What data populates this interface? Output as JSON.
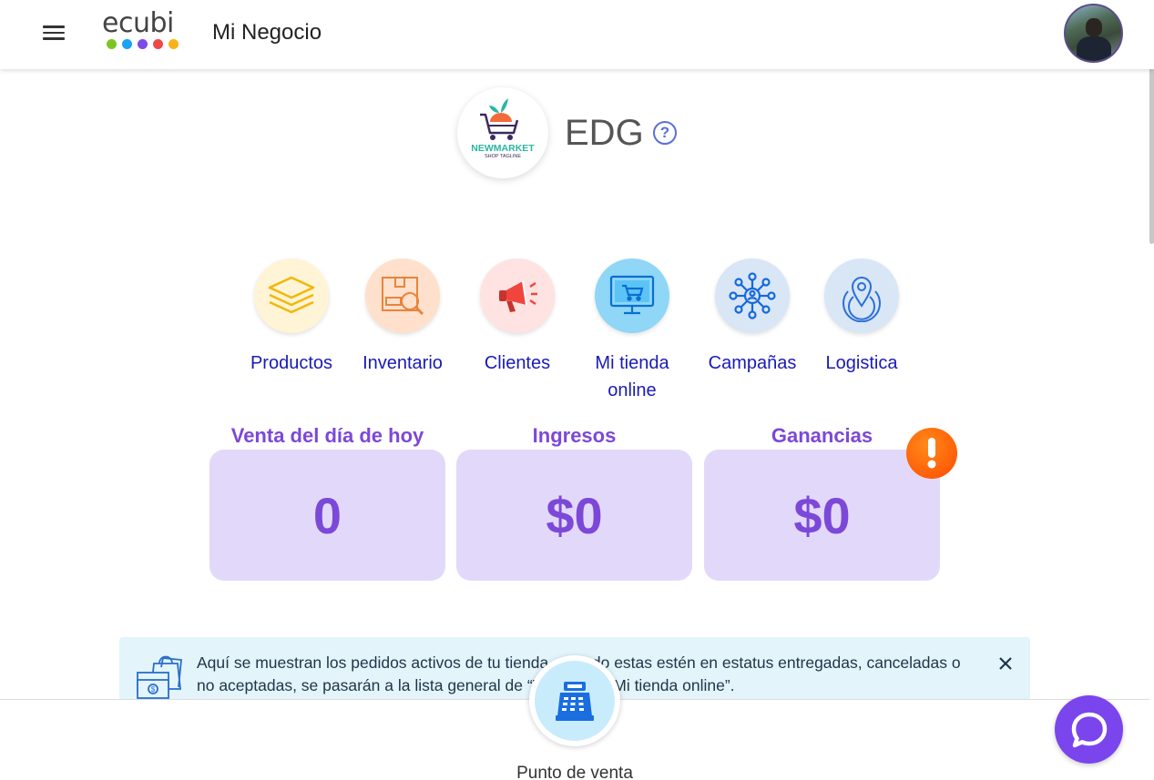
{
  "header": {
    "menu_icon": "hamburger-menu-icon",
    "logo_text": "ecubi",
    "logo_dot_colors": [
      "#7cc623",
      "#1aa3f0",
      "#7d4ce6",
      "#f04848",
      "#f7b319"
    ],
    "title": "Mi Negocio",
    "avatar": "user-avatar"
  },
  "store": {
    "logo_name": "NEWMARKET",
    "logo_tagline": "SHOP TAGLINE",
    "name": "EDG",
    "help_glyph": "?"
  },
  "modules": [
    {
      "label": "Productos",
      "icon": "layers-icon",
      "bg": "#fff4d6"
    },
    {
      "label": "Inventario",
      "icon": "box-search-icon",
      "bg": "#ffe0cc"
    },
    {
      "label": "Clientes",
      "icon": "megaphone-icon",
      "bg": "#ffe2e2"
    },
    {
      "label": "Mi tienda online",
      "icon": "online-store-icon",
      "bg": "#8fd6f7"
    },
    {
      "label": "Campañas",
      "icon": "network-icon",
      "bg": "#d8e6f6"
    },
    {
      "label": "Logistica",
      "icon": "location-pin-icon",
      "bg": "#d8e6f6"
    }
  ],
  "stats": [
    {
      "title": "Venta del día de hoy",
      "value": "0"
    },
    {
      "title": "Ingresos",
      "value": "$0"
    },
    {
      "title": "Ganancias",
      "value": "$0"
    }
  ],
  "alert_glyph": "!",
  "info": {
    "line1": "Aquí se muestran los pedidos activos de tu tienda, cuando estas estén en estatus entregadas, canceladas o",
    "line2": "no aceptadas, se pasarán a la lista general de “Ventas” en Mi tienda online”."
  },
  "bottom": {
    "pos_label": "Punto de venta"
  },
  "colors": {
    "accent": "#7c48d8",
    "link": "#1a1ab8",
    "stat_bg": "#e2d9fa",
    "chat": "#7a45ec"
  }
}
